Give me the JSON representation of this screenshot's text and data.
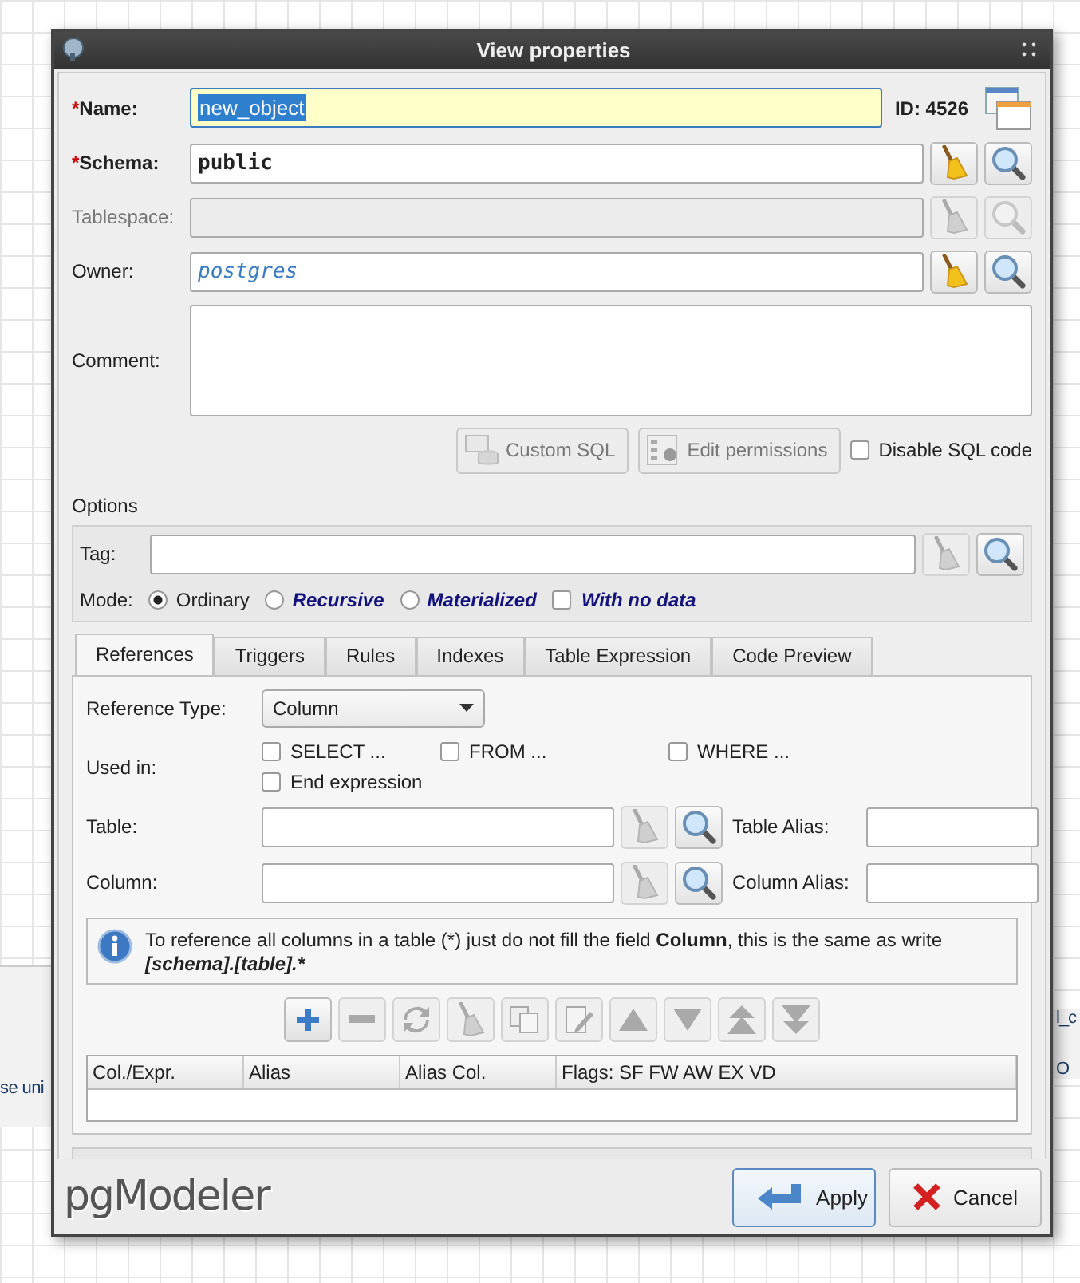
{
  "background": {
    "left_text": "se uni",
    "right_texts": [
      "l_c",
      "O"
    ]
  },
  "window": {
    "title": "View properties"
  },
  "name": {
    "marker": "*",
    "label": "Name:",
    "value": "new_object",
    "id": "ID: 4526"
  },
  "schema": {
    "marker": "*",
    "label": "Schema:",
    "value": "public",
    "disabled": false
  },
  "tablespace": {
    "label": "Tablespace:",
    "disabled": true
  },
  "owner": {
    "label": "Owner:",
    "value": "postgres",
    "disabled": false
  },
  "comment": {
    "label": "Comment:"
  },
  "actions": [
    {
      "label": "Custom SQL",
      "kind": "sql",
      "disabled": true
    },
    {
      "label": "Edit permissions",
      "kind": "permissions",
      "disabled": true
    }
  ],
  "disable_sql": {
    "label": "Disable SQL code",
    "checked": false
  },
  "options": {
    "title": "Options",
    "tag_label": "Tag:",
    "mode_label": "Mode:",
    "modes": [
      {
        "label": "Ordinary",
        "selected": true,
        "emphasis": false
      },
      {
        "label": "Recursive",
        "selected": false,
        "emphasis": true
      },
      {
        "label": "Materialized",
        "selected": false,
        "emphasis": true
      }
    ],
    "with_no_data": {
      "label": "With no data",
      "checked": false
    }
  },
  "tabs": [
    {
      "label": "References",
      "selected": true
    },
    {
      "label": "Triggers",
      "selected": false
    },
    {
      "label": "Rules",
      "selected": false
    },
    {
      "label": "Indexes",
      "selected": false
    },
    {
      "label": "Table Expression",
      "selected": false
    },
    {
      "label": "Code Preview",
      "selected": false
    }
  ],
  "references": {
    "reference_type": {
      "label": "Reference Type:",
      "value": "Column"
    },
    "used_in": {
      "label": "Used in:",
      "options": [
        {
          "label": "SELECT ...",
          "checked": false
        },
        {
          "label": "FROM ...",
          "checked": false
        },
        {
          "label": "WHERE ...",
          "checked": false
        },
        {
          "label": "End expression",
          "checked": false
        }
      ]
    },
    "table": {
      "label": "Table:",
      "alias_label": "Table Alias:"
    },
    "column": {
      "label": "Column:",
      "alias_label": "Column Alias:"
    },
    "note": {
      "text": "To reference all columns in a table (*) just do not fill the field **Column**, this is the same as write",
      "code": "[schema].[table].*"
    },
    "toolbar": [
      {
        "kind": "add",
        "disabled": false
      },
      {
        "kind": "remove",
        "disabled": true
      },
      {
        "kind": "refresh",
        "disabled": true
      },
      {
        "kind": "clear",
        "disabled": true
      },
      {
        "kind": "duplicate",
        "disabled": true
      },
      {
        "kind": "edit",
        "disabled": true
      },
      {
        "kind": "up",
        "disabled": true
      },
      {
        "kind": "down",
        "disabled": true
      },
      {
        "kind": "top",
        "disabled": true
      },
      {
        "kind": "bottom",
        "disabled": true
      }
    ],
    "columns": [
      "Col./Expr.",
      "Alias",
      "Alias Col.",
      "Flags: SF FW AW EX VD"
    ]
  },
  "footer": {
    "logo": "pgModeler",
    "apply": "Apply",
    "cancel": "Cancel"
  }
}
